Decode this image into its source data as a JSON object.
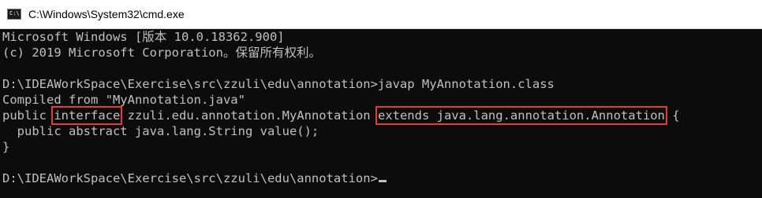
{
  "window": {
    "title": "C:\\Windows\\System32\\cmd.exe",
    "icon": "cmd-icon",
    "icon_glyph": "C:\\"
  },
  "console": {
    "banner_1": "Microsoft Windows [版本 10.0.18362.900]",
    "banner_2": "(c) 2019 Microsoft Corporation。保留所有权利。",
    "prompt_1": "D:\\IDEAWorkSpace\\Exercise\\src\\zzuli\\edu\\annotation>javap MyAnnotation.class",
    "compiled_from": "Compiled from \"MyAnnotation.java\"",
    "decl_public": "public ",
    "decl_interface": "interface",
    "decl_name": " zzuli.edu.annotation.MyAnnotation ",
    "decl_extends": "extends java.lang.annotation.Annotation",
    "decl_open": " {",
    "member": "  public abstract java.lang.String value();",
    "close": "}",
    "prompt_2": "D:\\IDEAWorkSpace\\Exercise\\src\\zzuli\\edu\\annotation>"
  },
  "colors": {
    "console_bg": "#0c0c0c",
    "console_text": "#c0c0c0",
    "highlight_box": "#e63b3b"
  }
}
